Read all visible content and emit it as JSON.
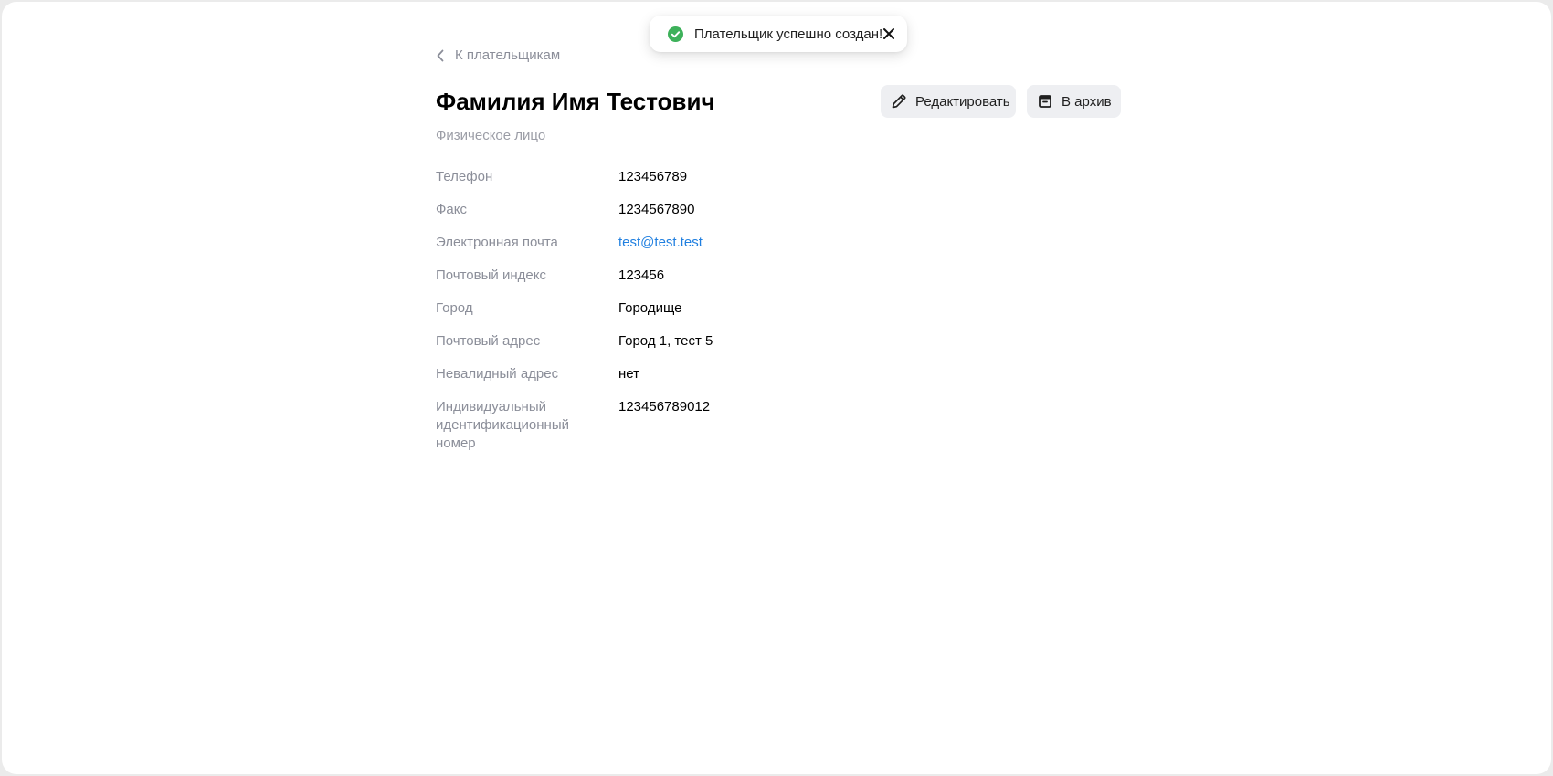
{
  "toast": {
    "message": "Плательщик успешно создан!",
    "status_color": "#3db15a"
  },
  "back_link": {
    "label": "К плательщикам"
  },
  "header": {
    "title": "Фамилия Имя Тестович",
    "subtitle": "Физическое лицо"
  },
  "actions": {
    "edit_label": "Редактировать",
    "archive_label": "В архив"
  },
  "details": [
    {
      "label": "Телефон",
      "value": "123456789"
    },
    {
      "label": "Факс",
      "value": "1234567890"
    },
    {
      "label": "Электронная почта",
      "value": "test@test.test",
      "is_link": true
    },
    {
      "label": "Почтовый индекс",
      "value": "123456"
    },
    {
      "label": "Город",
      "value": "Городище"
    },
    {
      "label": "Почтовый адрес",
      "value": "Город 1, тест 5"
    },
    {
      "label": "Невалидный адрес",
      "value": "нет"
    },
    {
      "label": "Индивидуальный идентификационный номер",
      "value": "123456789012"
    }
  ],
  "colors": {
    "link": "#1f7fe0",
    "label": "#8b8e99",
    "button_bg": "#eeeff2"
  }
}
